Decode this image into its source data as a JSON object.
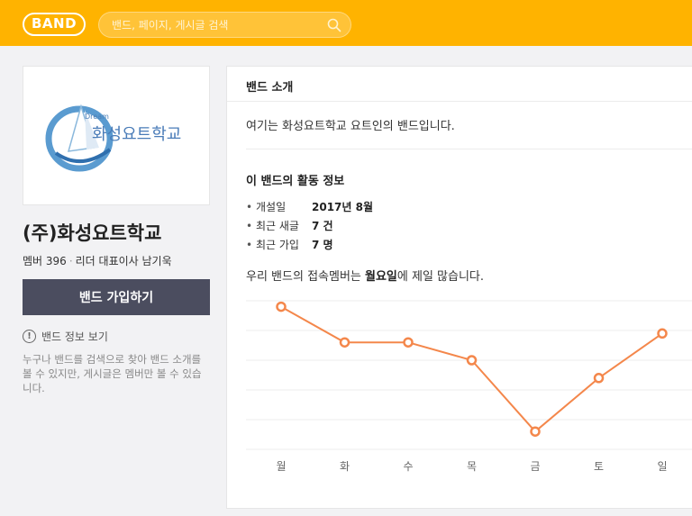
{
  "header": {
    "logo": "BAND",
    "search_placeholder": "밴드, 페이지, 게시글 검색"
  },
  "sidebar": {
    "cover_text": "화성요트학교",
    "cover_tagline": "Dream",
    "band_name": "(주)화성요트학교",
    "member_label": "멤버 396",
    "leader_label": "리더 대표이사 남기욱",
    "join_button": "밴드 가입하기",
    "info_link": "밴드 정보 보기",
    "info_icon": "!",
    "description": "누구나 밴드를 검색으로 찾아 밴드 소개를 볼 수 있지만, 게시글은 멤버만 볼 수 있습니다."
  },
  "main": {
    "title": "밴드 소개",
    "intro": "여기는 화성요트학교 요트인의 밴드입니다.",
    "activity_title": "이 밴드의 활동 정보",
    "stats": [
      {
        "label": "개설일",
        "value": "2017년 8월"
      },
      {
        "label": "최근 새글",
        "value": "7 건"
      },
      {
        "label": "최근 가입",
        "value": "7 명"
      }
    ],
    "summary_prefix": "우리 밴드의 접속멤버는 ",
    "summary_day": "월요일",
    "summary_suffix": "에 제일 많습니다."
  },
  "colors": {
    "header": "#ffb300",
    "join_button": "#4b4d5f",
    "line": "#f4874b"
  },
  "chart_data": {
    "type": "line",
    "categories": [
      "월",
      "화",
      "수",
      "목",
      "금",
      "토",
      "일"
    ],
    "series": [
      {
        "values": [
          5.8,
          4.6,
          4.6,
          4.0,
          1.6,
          3.4,
          4.9
        ]
      }
    ],
    "ylim": [
      1,
      6
    ],
    "grid": true,
    "legend": "none"
  }
}
